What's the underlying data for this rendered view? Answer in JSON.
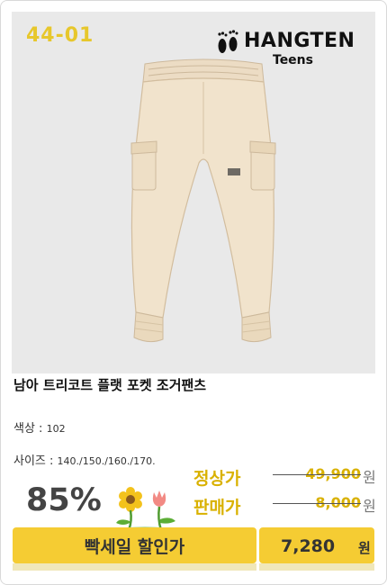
{
  "product_code": "44-01",
  "brand": {
    "name": "HANGTEN",
    "sub": "Teens"
  },
  "product": {
    "title": "남아 트리코트 플랫 포켓 조거팬츠",
    "color_label": "색상 : ",
    "color_value": "102",
    "size_label": "사이즈 : ",
    "size_value": "140./150./160./170."
  },
  "pricing": {
    "discount": "85%",
    "regular_label": "정상가",
    "regular_price": "49,900",
    "sale_label": "판매가",
    "sale_price": "8,000",
    "won": "원"
  },
  "banner": {
    "label": "빡세일 할인가",
    "final_price": "7,280",
    "won": "원"
  },
  "icons": {
    "brand_logo": "footprints-icon",
    "decoration": "flowers-icon"
  },
  "colors": {
    "accent_yellow": "#f5cc33",
    "code_yellow": "#e7c72c",
    "price_yellow": "#d9b100",
    "photo_bg": "#e9e9e9"
  }
}
